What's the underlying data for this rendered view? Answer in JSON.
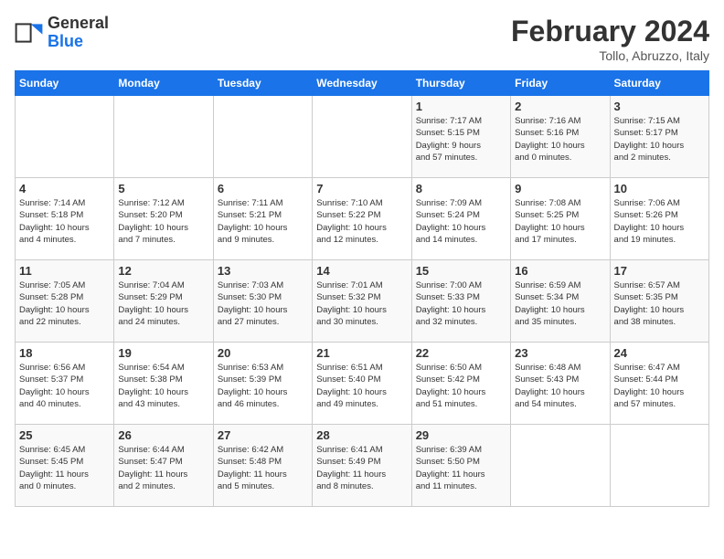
{
  "header": {
    "logo_general": "General",
    "logo_blue": "Blue",
    "month_title": "February 2024",
    "subtitle": "Tollo, Abruzzo, Italy"
  },
  "days_of_week": [
    "Sunday",
    "Monday",
    "Tuesday",
    "Wednesday",
    "Thursday",
    "Friday",
    "Saturday"
  ],
  "weeks": [
    [
      {
        "day": "",
        "info": ""
      },
      {
        "day": "",
        "info": ""
      },
      {
        "day": "",
        "info": ""
      },
      {
        "day": "",
        "info": ""
      },
      {
        "day": "1",
        "info": "Sunrise: 7:17 AM\nSunset: 5:15 PM\nDaylight: 9 hours\nand 57 minutes."
      },
      {
        "day": "2",
        "info": "Sunrise: 7:16 AM\nSunset: 5:16 PM\nDaylight: 10 hours\nand 0 minutes."
      },
      {
        "day": "3",
        "info": "Sunrise: 7:15 AM\nSunset: 5:17 PM\nDaylight: 10 hours\nand 2 minutes."
      }
    ],
    [
      {
        "day": "4",
        "info": "Sunrise: 7:14 AM\nSunset: 5:18 PM\nDaylight: 10 hours\nand 4 minutes."
      },
      {
        "day": "5",
        "info": "Sunrise: 7:12 AM\nSunset: 5:20 PM\nDaylight: 10 hours\nand 7 minutes."
      },
      {
        "day": "6",
        "info": "Sunrise: 7:11 AM\nSunset: 5:21 PM\nDaylight: 10 hours\nand 9 minutes."
      },
      {
        "day": "7",
        "info": "Sunrise: 7:10 AM\nSunset: 5:22 PM\nDaylight: 10 hours\nand 12 minutes."
      },
      {
        "day": "8",
        "info": "Sunrise: 7:09 AM\nSunset: 5:24 PM\nDaylight: 10 hours\nand 14 minutes."
      },
      {
        "day": "9",
        "info": "Sunrise: 7:08 AM\nSunset: 5:25 PM\nDaylight: 10 hours\nand 17 minutes."
      },
      {
        "day": "10",
        "info": "Sunrise: 7:06 AM\nSunset: 5:26 PM\nDaylight: 10 hours\nand 19 minutes."
      }
    ],
    [
      {
        "day": "11",
        "info": "Sunrise: 7:05 AM\nSunset: 5:28 PM\nDaylight: 10 hours\nand 22 minutes."
      },
      {
        "day": "12",
        "info": "Sunrise: 7:04 AM\nSunset: 5:29 PM\nDaylight: 10 hours\nand 24 minutes."
      },
      {
        "day": "13",
        "info": "Sunrise: 7:03 AM\nSunset: 5:30 PM\nDaylight: 10 hours\nand 27 minutes."
      },
      {
        "day": "14",
        "info": "Sunrise: 7:01 AM\nSunset: 5:32 PM\nDaylight: 10 hours\nand 30 minutes."
      },
      {
        "day": "15",
        "info": "Sunrise: 7:00 AM\nSunset: 5:33 PM\nDaylight: 10 hours\nand 32 minutes."
      },
      {
        "day": "16",
        "info": "Sunrise: 6:59 AM\nSunset: 5:34 PM\nDaylight: 10 hours\nand 35 minutes."
      },
      {
        "day": "17",
        "info": "Sunrise: 6:57 AM\nSunset: 5:35 PM\nDaylight: 10 hours\nand 38 minutes."
      }
    ],
    [
      {
        "day": "18",
        "info": "Sunrise: 6:56 AM\nSunset: 5:37 PM\nDaylight: 10 hours\nand 40 minutes."
      },
      {
        "day": "19",
        "info": "Sunrise: 6:54 AM\nSunset: 5:38 PM\nDaylight: 10 hours\nand 43 minutes."
      },
      {
        "day": "20",
        "info": "Sunrise: 6:53 AM\nSunset: 5:39 PM\nDaylight: 10 hours\nand 46 minutes."
      },
      {
        "day": "21",
        "info": "Sunrise: 6:51 AM\nSunset: 5:40 PM\nDaylight: 10 hours\nand 49 minutes."
      },
      {
        "day": "22",
        "info": "Sunrise: 6:50 AM\nSunset: 5:42 PM\nDaylight: 10 hours\nand 51 minutes."
      },
      {
        "day": "23",
        "info": "Sunrise: 6:48 AM\nSunset: 5:43 PM\nDaylight: 10 hours\nand 54 minutes."
      },
      {
        "day": "24",
        "info": "Sunrise: 6:47 AM\nSunset: 5:44 PM\nDaylight: 10 hours\nand 57 minutes."
      }
    ],
    [
      {
        "day": "25",
        "info": "Sunrise: 6:45 AM\nSunset: 5:45 PM\nDaylight: 11 hours\nand 0 minutes."
      },
      {
        "day": "26",
        "info": "Sunrise: 6:44 AM\nSunset: 5:47 PM\nDaylight: 11 hours\nand 2 minutes."
      },
      {
        "day": "27",
        "info": "Sunrise: 6:42 AM\nSunset: 5:48 PM\nDaylight: 11 hours\nand 5 minutes."
      },
      {
        "day": "28",
        "info": "Sunrise: 6:41 AM\nSunset: 5:49 PM\nDaylight: 11 hours\nand 8 minutes."
      },
      {
        "day": "29",
        "info": "Sunrise: 6:39 AM\nSunset: 5:50 PM\nDaylight: 11 hours\nand 11 minutes."
      },
      {
        "day": "",
        "info": ""
      },
      {
        "day": "",
        "info": ""
      }
    ]
  ]
}
